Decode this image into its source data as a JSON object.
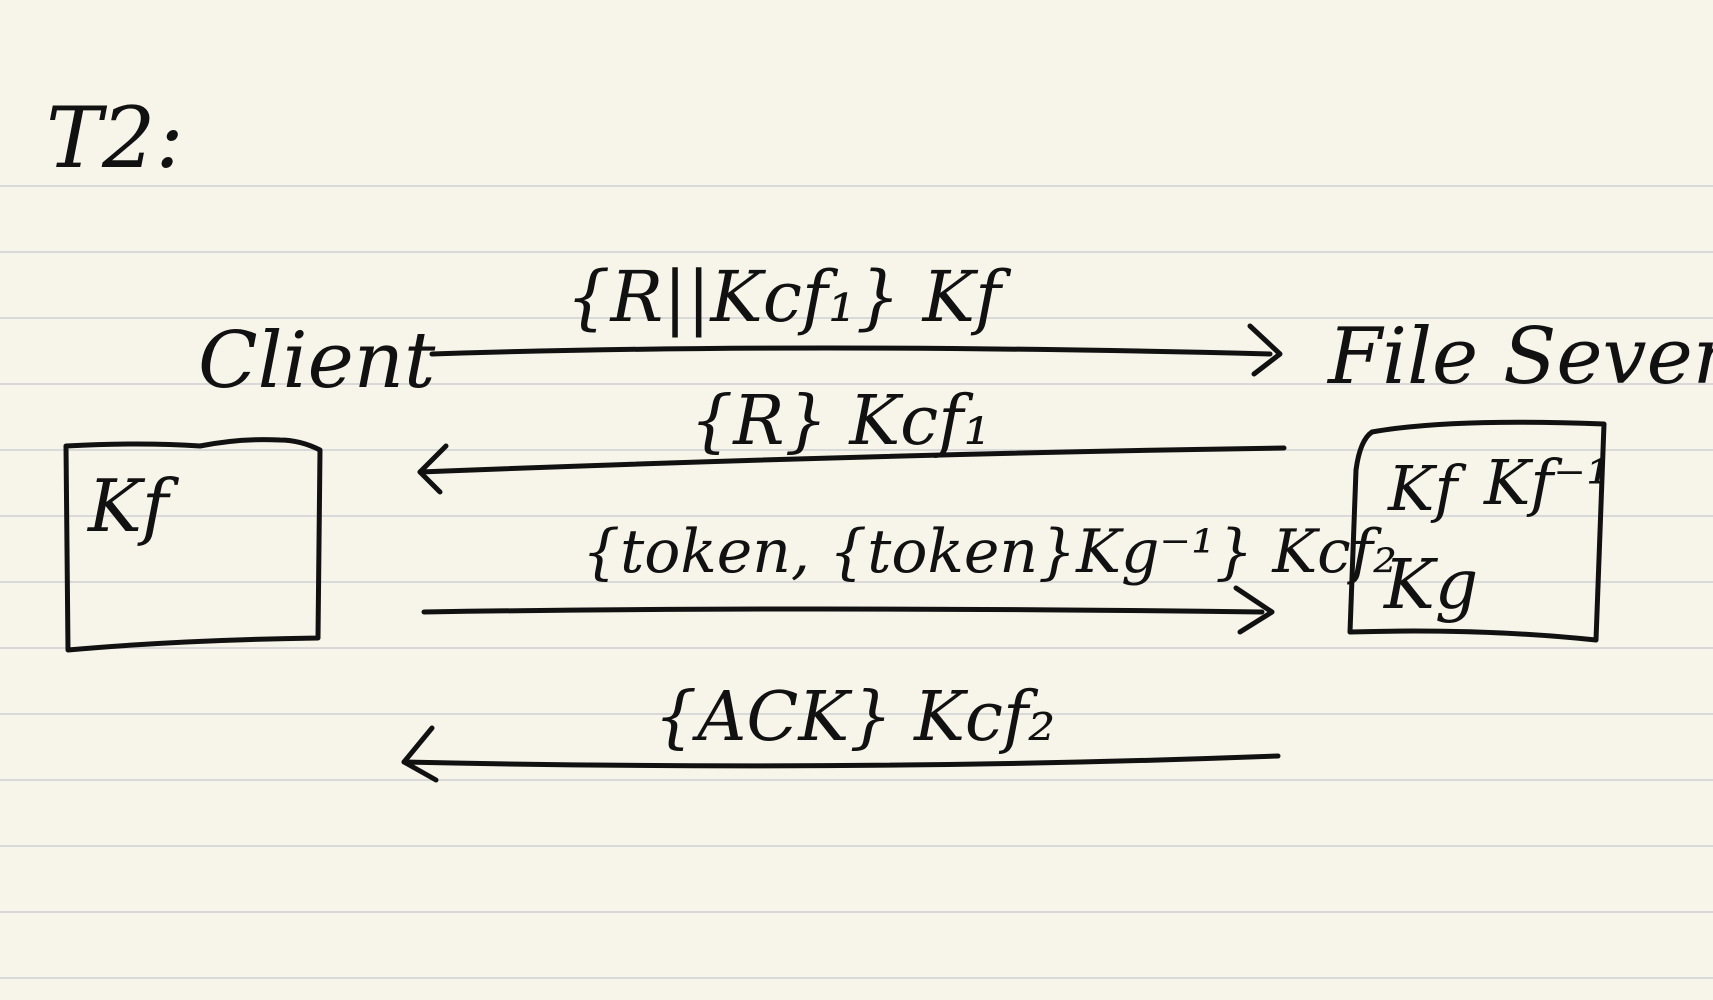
{
  "page": {
    "title": "T2:",
    "background": "#f7f5ea",
    "ruled_line_color": "#d9d9d9",
    "ink_color": "#111111"
  },
  "client": {
    "label": "Client",
    "box_keys": [
      "Kf"
    ]
  },
  "server": {
    "label": "File Sever",
    "box_keys": [
      "Kf",
      "Kf⁻¹",
      "Kg"
    ]
  },
  "messages": [
    {
      "text": "{R||Kcf₁} Kf",
      "direction": "client-to-server"
    },
    {
      "text": "{R} Kcf₁",
      "direction": "server-to-client"
    },
    {
      "text": "{token, {token}Kg⁻¹} Kcf₂",
      "direction": "client-to-server"
    },
    {
      "text": "{ACK} Kcf₂",
      "direction": "server-to-client"
    }
  ]
}
